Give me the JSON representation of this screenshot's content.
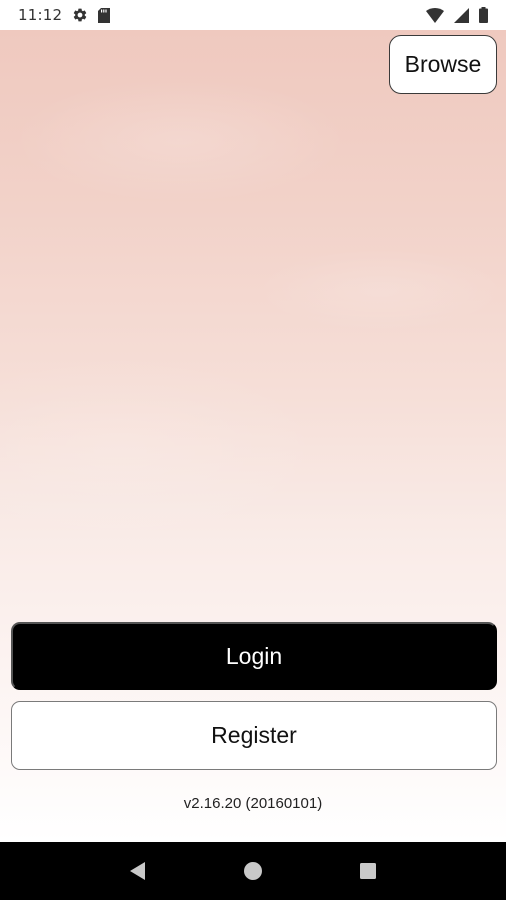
{
  "status_bar": {
    "time": "11:12",
    "left_icons": [
      "settings-icon",
      "sd-card-icon"
    ],
    "right_icons": [
      "wifi-icon",
      "signal-icon",
      "battery-icon"
    ]
  },
  "header": {
    "browse_label": "Browse"
  },
  "auth": {
    "login_label": "Login",
    "register_label": "Register"
  },
  "footer": {
    "version": "v2.16.20 (20160101)"
  },
  "navigation": {
    "back_icon": "back-triangle-icon",
    "home_icon": "home-circle-icon",
    "recents_icon": "recents-square-icon"
  },
  "colors": {
    "primary": "#000000",
    "background_top": "#efc9bf",
    "background_bottom": "#ffffff",
    "text": "#111111",
    "status_text": "#333333",
    "nav_bar": "#000000"
  }
}
